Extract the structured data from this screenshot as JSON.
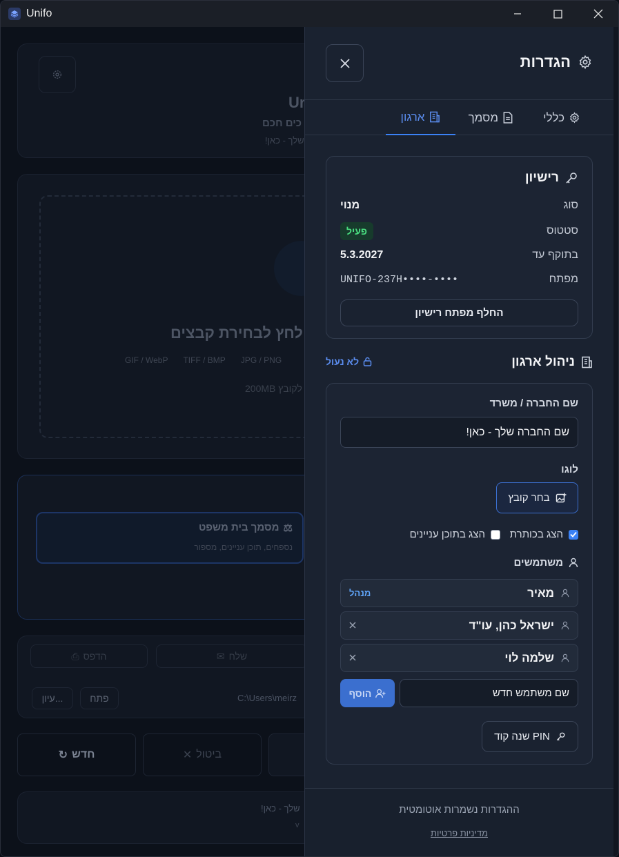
{
  "window": {
    "title": "Unifo"
  },
  "background": {
    "app_name_partial": "Ur",
    "subtitle_partial": "כים חכם",
    "tagline_partial": "שלך - כאן!",
    "drop_text": "לחץ לבחירת קבצים",
    "formats": [
      "GIF / WebP",
      "TIFF / BMP",
      "JPG / PNG"
    ],
    "size_note_partial": "200MB לקובץ",
    "doc_type_title": "מסמך בית משפט",
    "doc_type_desc": "נספחים, תוכן עניינים, מספור",
    "print_label": "הדפס",
    "send_label": "שלח",
    "path_partial": "C:\\Users\\meirz",
    "open_label": "פתח",
    "browse_label": "עיון...",
    "new_label": "חדש",
    "cancel_label": "ביטול",
    "footer_tagline_partial": "שלך - כאן!",
    "footer_version_partial": "v"
  },
  "settings": {
    "title": "הגדרות",
    "tabs": [
      {
        "label": "כללי",
        "icon": "gear-icon"
      },
      {
        "label": "מסמך",
        "icon": "document-icon"
      },
      {
        "label": "ארגון",
        "icon": "building-icon",
        "active": true
      }
    ],
    "license": {
      "title": "רישיון",
      "type_label": "סוג",
      "type_value": "מנוי",
      "status_label": "סטטוס",
      "status_value": "פעיל",
      "valid_label": "בתוקף עד",
      "valid_value": "5.3.2027",
      "key_label": "מפתח",
      "key_value": "UNIFO-237H••••-••••",
      "replace_button": "החלף מפתח רישיון"
    },
    "org": {
      "title": "ניהול ארגון",
      "lock_status": "לא נעול",
      "company_label": "שם החברה / משרד",
      "company_value": "שם החברה שלך - כאן!",
      "logo_label": "לוגו",
      "choose_file": "בחר קובץ",
      "show_header": "הצג בכותרת",
      "show_header_checked": true,
      "show_toc": "הצג בתוכן עניינים",
      "show_toc_checked": false,
      "users_label": "משתמשים",
      "users": [
        {
          "name": "מאיר",
          "role": "מנהל"
        },
        {
          "name": "ישראל כהן, עו\"ד",
          "role": ""
        },
        {
          "name": "שלמה לוי",
          "role": ""
        }
      ],
      "new_user_placeholder": "שם משתמש חדש",
      "add_button": "הוסף",
      "change_pin": "שנה קוד PIN"
    },
    "footer": {
      "autosave": "ההגדרות נשמרות אוטומטית",
      "privacy": "מדיניות פרטיות"
    }
  },
  "colors": {
    "accent": "#3b82f6",
    "panel": "#1a2230",
    "active_green": "#4ade80"
  }
}
